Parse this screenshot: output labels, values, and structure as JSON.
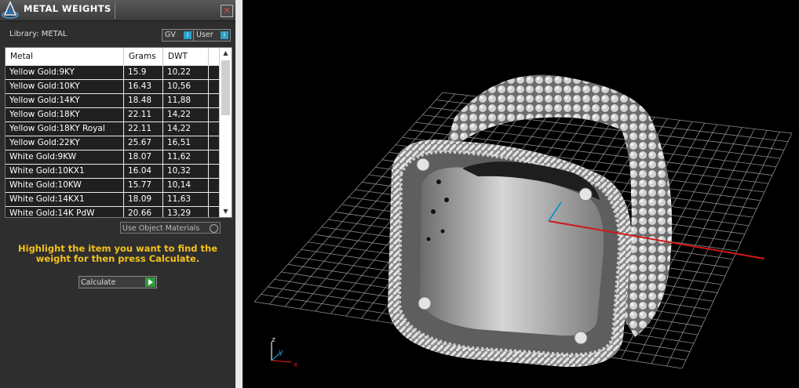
{
  "panel": {
    "title": "METAL WEIGHTS",
    "close_icon": "close-icon",
    "library_label": "Library: METAL",
    "toggles": [
      {
        "label": "GV",
        "indicator": "i"
      },
      {
        "label": "User",
        "indicator": "i"
      }
    ],
    "columns": [
      "Metal",
      "Grams",
      "DWT"
    ],
    "rows": [
      {
        "metal": "Yellow Gold:9KY",
        "grams": "15.9",
        "dwt": "10,22"
      },
      {
        "metal": "Yellow Gold:10KY",
        "grams": "16.43",
        "dwt": "10,56"
      },
      {
        "metal": "Yellow Gold:14KY",
        "grams": "18.48",
        "dwt": "11,88"
      },
      {
        "metal": "Yellow Gold:18KY",
        "grams": "22.11",
        "dwt": "14,22"
      },
      {
        "metal": "Yellow Gold:18KY Royal",
        "grams": "22.11",
        "dwt": "14,22"
      },
      {
        "metal": "Yellow Gold:22KY",
        "grams": "25.67",
        "dwt": "16,51"
      },
      {
        "metal": "White Gold:9KW",
        "grams": "18.07",
        "dwt": "11,62"
      },
      {
        "metal": "White Gold:10KX1",
        "grams": "16.04",
        "dwt": "10,32"
      },
      {
        "metal": "White Gold:10KW",
        "grams": "15.77",
        "dwt": "10,14"
      },
      {
        "metal": "White Gold:14KX1",
        "grams": "18.09",
        "dwt": "11,63"
      },
      {
        "metal": "White Gold:14K PdW",
        "grams": "20.66",
        "dwt": "13,29"
      }
    ],
    "use_object_materials": "Use Object Materials",
    "hint": "Highlight the item you want to find the weight for then press Calculate.",
    "calculate_label": "Calculate"
  },
  "viewport": {
    "axis_labels": {
      "z": "z",
      "y": "y",
      "x": "x"
    },
    "colors": {
      "x_axis": "#d01818",
      "y_axis": "#1890c8",
      "z_axis": "#e8e8e8",
      "grid": "#8a8a8a"
    }
  }
}
